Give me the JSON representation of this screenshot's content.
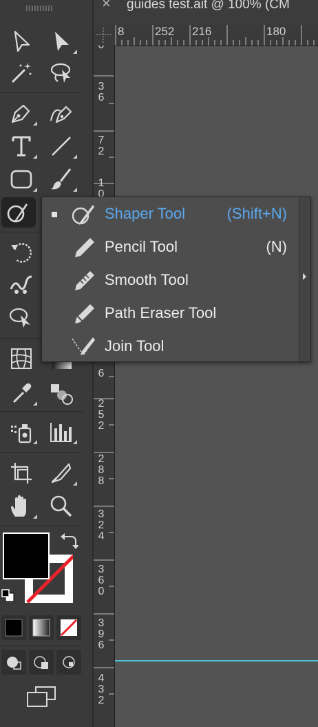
{
  "document_tab": {
    "close_glyph": "×",
    "title": "guides test.ait @ 100% (CM"
  },
  "rulers": {
    "horizontal_labels": [
      "8",
      "252",
      "216",
      "180"
    ],
    "vertical_labels": [
      "0",
      "36",
      "72",
      "10",
      "6",
      "252",
      "288",
      "324",
      "360",
      "396",
      "432"
    ]
  },
  "colors": {
    "guide": "#4cc3d9",
    "selected_menu_text": "#5aa9f0",
    "no_stroke": "#e8222b",
    "panel": "#3a3a3a",
    "canvas": "#535353"
  },
  "toolbar": {
    "tools": [
      {
        "name": "selection-tool",
        "icon": "arrow-outline-icon"
      },
      {
        "name": "direct-selection-tool",
        "icon": "arrow-filled-icon"
      },
      {
        "name": "magic-wand-tool",
        "icon": "magic-wand-icon"
      },
      {
        "name": "lasso-tool",
        "icon": "lasso-icon"
      },
      {
        "name": "pen-tool",
        "icon": "pen-nib-icon"
      },
      {
        "name": "curvature-tool",
        "icon": "curvature-pen-icon"
      },
      {
        "name": "type-tool",
        "icon": "type-t-icon"
      },
      {
        "name": "line-segment-tool",
        "icon": "line-icon"
      },
      {
        "name": "rectangle-tool",
        "icon": "rounded-rectangle-icon"
      },
      {
        "name": "paintbrush-tool",
        "icon": "paintbrush-icon"
      },
      {
        "name": "shaper-tool",
        "icon": "shaper-icon"
      },
      {
        "name": "rotate-tool",
        "icon": "rotate-icon"
      },
      {
        "name": "warp-tool",
        "icon": "warp-icon"
      },
      {
        "name": "free-transform-tool",
        "icon": "free-transform-icon"
      },
      {
        "name": "mesh-tool",
        "icon": "mesh-icon"
      },
      {
        "name": "gradient-tool",
        "icon": "gradient-icon"
      },
      {
        "name": "eyedropper-tool",
        "icon": "eyedropper-icon"
      },
      {
        "name": "blend-tool",
        "icon": "blend-icon"
      },
      {
        "name": "symbol-sprayer-tool",
        "icon": "symbol-sprayer-icon"
      },
      {
        "name": "column-graph-tool",
        "icon": "bar-graph-icon"
      },
      {
        "name": "artboard-tool",
        "icon": "artboard-icon"
      },
      {
        "name": "slice-tool",
        "icon": "slice-knife-icon"
      },
      {
        "name": "hand-tool",
        "icon": "hand-icon"
      },
      {
        "name": "zoom-tool",
        "icon": "magnifier-icon"
      }
    ],
    "fill_color": "#000000",
    "stroke": "none"
  },
  "flyout": {
    "items": [
      {
        "label": "Shaper Tool",
        "shortcut": "(Shift+N)",
        "icon": "shaper-icon",
        "selected": true
      },
      {
        "label": "Pencil Tool",
        "shortcut": "(N)",
        "icon": "pencil-icon",
        "selected": false
      },
      {
        "label": "Smooth Tool",
        "shortcut": "",
        "icon": "smooth-icon",
        "selected": false
      },
      {
        "label": "Path Eraser Tool",
        "shortcut": "",
        "icon": "path-eraser-icon",
        "selected": false
      },
      {
        "label": "Join Tool",
        "shortcut": "",
        "icon": "join-icon",
        "selected": false
      }
    ]
  }
}
